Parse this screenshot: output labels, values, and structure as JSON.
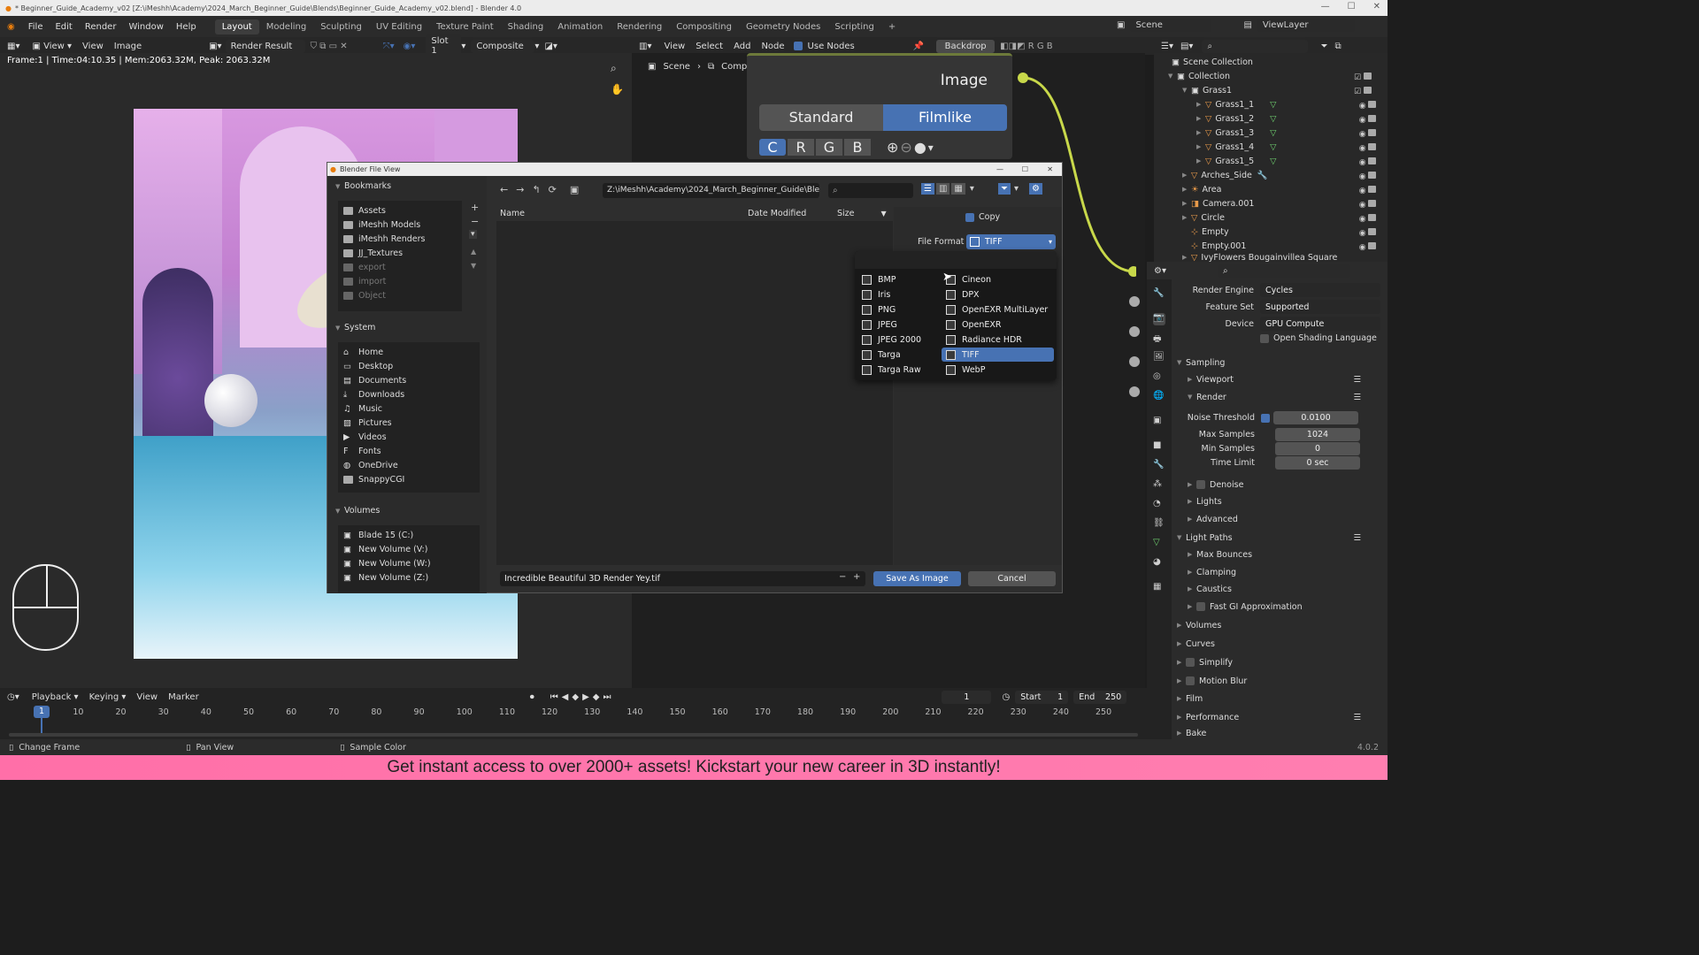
{
  "titlebar": {
    "title": "* Beginner_Guide_Academy_v02 [Z:\\iMeshh\\Academy\\2024_March_Beginner_Guide\\Blends\\Beginner_Guide_Academy_v02.blend] - Blender 4.0"
  },
  "menu": {
    "items": [
      "File",
      "Edit",
      "Render",
      "Window",
      "Help"
    ]
  },
  "workspaces": [
    "Layout",
    "Modeling",
    "Sculpting",
    "UV Editing",
    "Texture Paint",
    "Shading",
    "Animation",
    "Rendering",
    "Compositing",
    "Geometry Nodes",
    "Scripting"
  ],
  "scene": {
    "label": "Scene",
    "view_layer": "ViewLayer"
  },
  "image_editor": {
    "view": "View",
    "view2": "View",
    "image": "Image",
    "image_name": "Render Result",
    "slot": "Slot 1",
    "composite": "Composite",
    "stats": "Frame:1 | Time:04:10.35 | Mem:2063.32M, Peak: 2063.32M"
  },
  "node_editor": {
    "view": "View",
    "select": "Select",
    "add": "Add",
    "node": "Node",
    "use_nodes": "Use Nodes",
    "backdrop": "Backdrop",
    "channels": [
      "R",
      "G",
      "B"
    ],
    "breadcrumb_scene": "Scene",
    "breadcrumb_tree": "Compositing Nodetree",
    "image_label": "Image",
    "view_standard": "Standard",
    "view_filmlike": "Filmlike",
    "channel_buttons": [
      "C",
      "R",
      "G",
      "B"
    ]
  },
  "outliner": {
    "items": [
      {
        "label": "Scene Collection",
        "level": 0
      },
      {
        "label": "Collection",
        "level": 1
      },
      {
        "label": "Grass1",
        "level": 2
      },
      {
        "label": "Grass1_1",
        "level": 3
      },
      {
        "label": "Grass1_2",
        "level": 3
      },
      {
        "label": "Grass1_3",
        "level": 3
      },
      {
        "label": "Grass1_4",
        "level": 3
      },
      {
        "label": "Grass1_5",
        "level": 3
      },
      {
        "label": "Arches_Side",
        "level": 2
      },
      {
        "label": "Area",
        "level": 2
      },
      {
        "label": "Camera.001",
        "level": 2
      },
      {
        "label": "Circle",
        "level": 2
      },
      {
        "label": "Empty",
        "level": 2
      },
      {
        "label": "Empty.001",
        "level": 2
      },
      {
        "label": "IvyFlowers Bougainvillea Square",
        "level": 2
      }
    ]
  },
  "render_props": {
    "render_engine_label": "Render Engine",
    "render_engine": "Cycles",
    "feature_set_label": "Feature Set",
    "feature_set": "Supported",
    "device_label": "Device",
    "device": "GPU Compute",
    "osl": "Open Shading Language",
    "sampling": "Sampling",
    "viewport": "Viewport",
    "render": "Render",
    "noise_threshold_label": "Noise Threshold",
    "noise_threshold": "0.0100",
    "max_samples_label": "Max Samples",
    "max_samples": "1024",
    "min_samples_label": "Min Samples",
    "min_samples": "0",
    "time_limit_label": "Time Limit",
    "time_limit": "0 sec",
    "denoise": "Denoise",
    "lights": "Lights",
    "advanced": "Advanced",
    "light_paths": "Light Paths",
    "max_bounces": "Max Bounces",
    "clamping": "Clamping",
    "caustics": "Caustics",
    "fast_gi": "Fast GI Approximation",
    "volumes": "Volumes",
    "curves": "Curves",
    "simplify": "Simplify",
    "motion_blur": "Motion Blur",
    "film": "Film",
    "performance": "Performance",
    "bake": "Bake"
  },
  "dialog": {
    "title": "Blender File View",
    "bookmarks_header": "Bookmarks",
    "bookmarks": [
      "Assets",
      "iMeshh Models",
      "iMeshh Renders",
      "JJ_Textures",
      "export",
      "import",
      "Object"
    ],
    "system_header": "System",
    "system": [
      "Home",
      "Desktop",
      "Documents",
      "Downloads",
      "Music",
      "Pictures",
      "Videos",
      "Fonts",
      "OneDrive",
      "SnappyCGI"
    ],
    "volumes_header": "Volumes",
    "volumes": [
      "Blade 15 (C:)",
      "New Volume (V:)",
      "New Volume (W:)",
      "New Volume (Z:)"
    ],
    "path": "Z:\\iMeshh\\Academy\\2024_March_Beginner_Guide\\Blen...",
    "col_name": "Name",
    "col_date": "Date Modified",
    "col_size": "Size",
    "copy_label": "Copy",
    "file_format_label": "File Format",
    "file_format": "TIFF",
    "formats_left": [
      "BMP",
      "Iris",
      "PNG",
      "JPEG",
      "JPEG 2000",
      "Targa",
      "Targa Raw"
    ],
    "formats_right": [
      "Cineon",
      "DPX",
      "OpenEXR MultiLayer",
      "OpenEXR",
      "Radiance HDR",
      "TIFF",
      "WebP"
    ],
    "filename": "Incredible Beautiful 3D Render Yey.tif",
    "save_button": "Save As Image",
    "cancel_button": "Cancel"
  },
  "timeline": {
    "playback": "Playback",
    "keying": "Keying",
    "view": "View",
    "marker": "Marker",
    "current_frame": "1",
    "start_label": "Start",
    "start": "1",
    "end_label": "End",
    "end": "250",
    "ticks": [
      "1",
      "10",
      "20",
      "30",
      "40",
      "50",
      "60",
      "70",
      "80",
      "90",
      "100",
      "110",
      "120",
      "130",
      "140",
      "150",
      "160",
      "170",
      "180",
      "190",
      "200",
      "210",
      "220",
      "230",
      "240",
      "250"
    ]
  },
  "status": {
    "change_frame": "Change Frame",
    "pan_view": "Pan View",
    "sample_color": "Sample Color",
    "version": "4.0.2"
  },
  "banner": {
    "text": "Get instant access to over 2000+ assets! Kickstart your new career in 3D instantly!"
  },
  "colors": {
    "accent": "#4772b3",
    "node_wire": "#c8d84a",
    "banner": "#ff74ab"
  }
}
